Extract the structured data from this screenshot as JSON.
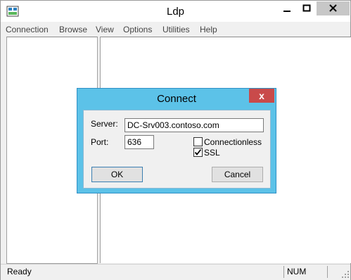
{
  "window": {
    "title": "Ldp",
    "controls": {
      "minimize": "–",
      "maximize": "□",
      "close": "✕"
    },
    "icon": "ldp-app-icon"
  },
  "menu": [
    {
      "label": "Connection"
    },
    {
      "label": "Browse"
    },
    {
      "label": "View"
    },
    {
      "label": "Options"
    },
    {
      "label": "Utilities"
    },
    {
      "label": "Help"
    }
  ],
  "status": {
    "text": "Ready",
    "num": "NUM"
  },
  "dialog": {
    "title": "Connect",
    "close": "x",
    "server_label": "Server:",
    "server_value": "DC-Srv003.contoso.com",
    "port_label": "Port:",
    "port_value": "636",
    "connectionless_label": "Connectionless",
    "connectionless_checked": false,
    "ssl_label": "SSL",
    "ssl_checked": true,
    "ok_label": "OK",
    "cancel_label": "Cancel"
  },
  "colors": {
    "dialog_frame": "#5cc2e8",
    "dialog_close": "#c94a4a",
    "window_bg": "#f0f0f0"
  }
}
